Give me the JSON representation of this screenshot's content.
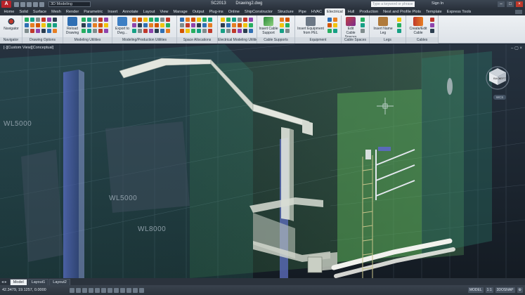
{
  "titlebar": {
    "logo": "A",
    "workspace": "3D Modeling",
    "app_name": "SC2013",
    "document": "Drawing2.dwg",
    "search_placeholder": "Type a keyword or phrase",
    "signin": "Sign In"
  },
  "tabs": [
    "Home",
    "Solid",
    "Surface",
    "Mesh",
    "Render",
    "Parametric",
    "Insert",
    "Annotate",
    "Layout",
    "View",
    "Manage",
    "Output",
    "Plug-ins",
    "Online",
    "ShipConstructor",
    "Structure",
    "Pipe",
    "HVAC",
    "Electrical",
    "Hull",
    "Production",
    "Nest and Profile Plots",
    "Template",
    "Express Tools"
  ],
  "active_tab": "Electrical",
  "ribbon": {
    "navigator": {
      "button": "Navigator",
      "title": "Navigator"
    },
    "drawing_options": {
      "title": "Drawing Options"
    },
    "modeling_utilities": {
      "reload": "Reload Drawing",
      "title": "Modeling Utilities"
    },
    "production_utilities": {
      "export": "Export to Dwg...",
      "title": "Modeling/Production Utilities"
    },
    "space_allocations": {
      "title": "Space Allocations"
    },
    "electrical_modeling": {
      "title": "Electrical Modeling Utilities"
    },
    "cable_supports": {
      "button": "Insert Cable Support",
      "title": "Cable Supports"
    },
    "equipment": {
      "button": "Insert Equipment from PEL",
      "title": "Equipment"
    },
    "cable_spaces": {
      "button": "Edit Cable Spaces",
      "title": "Cable Spaces"
    },
    "legs": {
      "button": "Insert Name Leg",
      "title": "Legs"
    },
    "cables": {
      "button": "Create/Edit Cable",
      "title": "Cables"
    }
  },
  "viewport": {
    "label": "[-][Custom View][Conceptual]",
    "wl_label_1": "WL5000",
    "wl_label_2": "WL5000",
    "wl_label_3": "WL8000",
    "wcs": "WCS",
    "viewcube_face": "BACK",
    "viewcube_side": "LEFT"
  },
  "layout_tabs": [
    "Model",
    "Layout1",
    "Layout2"
  ],
  "active_layout": "Model",
  "status": {
    "coords": "42.3479, 19.1257, 0.0000",
    "model": "MODEL",
    "scale": "1:1",
    "osnap": "3DOSNAP"
  },
  "colors": {
    "accent": "#b8232a",
    "viewport_bg": "#1b2430",
    "green_volume": "#4fa84a",
    "tray": "#d8dde2"
  }
}
